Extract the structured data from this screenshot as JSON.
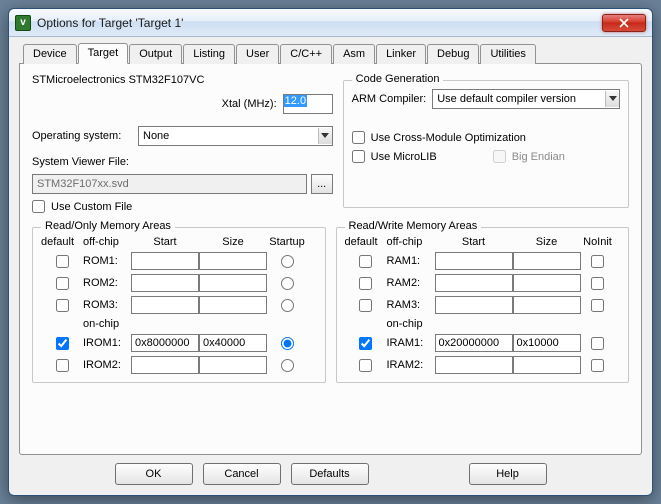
{
  "window": {
    "title": "Options for Target 'Target 1'"
  },
  "tabs": [
    "Device",
    "Target",
    "Output",
    "Listing",
    "User",
    "C/C++",
    "Asm",
    "Linker",
    "Debug",
    "Utilities"
  ],
  "active_tab": 1,
  "target": {
    "mcu_label": "STMicroelectronics STM32F107VC",
    "xtal_label": "Xtal (MHz):",
    "xtal_value": "12.0",
    "os_label": "Operating system:",
    "os_value": "None",
    "svf_label": "System Viewer File:",
    "svf_value": "STM32F107xx.svd",
    "svf_browse": "...",
    "custom_file_label": "Use Custom File",
    "custom_file_checked": false
  },
  "codegen": {
    "group": "Code Generation",
    "compiler_label": "ARM Compiler:",
    "compiler_value": "Use default compiler version",
    "cross_label": "Use Cross-Module Optimization",
    "cross_checked": false,
    "microlib_label": "Use MicroLIB",
    "microlib_checked": false,
    "bigendian_label": "Big Endian",
    "bigendian_checked": false
  },
  "ro": {
    "group": "Read/Only Memory Areas",
    "hdr_default": "default",
    "hdr_offchip": "off-chip",
    "hdr_start": "Start",
    "hdr_size": "Size",
    "hdr_startup": "Startup",
    "hdr_onchip": "on-chip",
    "rows_off": [
      {
        "label": "ROM1:",
        "checked": false,
        "start": "",
        "size": "",
        "startup": false
      },
      {
        "label": "ROM2:",
        "checked": false,
        "start": "",
        "size": "",
        "startup": false
      },
      {
        "label": "ROM3:",
        "checked": false,
        "start": "",
        "size": "",
        "startup": false
      }
    ],
    "rows_on": [
      {
        "label": "IROM1:",
        "checked": true,
        "start": "0x8000000",
        "size": "0x40000",
        "startup": true
      },
      {
        "label": "IROM2:",
        "checked": false,
        "start": "",
        "size": "",
        "startup": false
      }
    ]
  },
  "rw": {
    "group": "Read/Write Memory Areas",
    "hdr_default": "default",
    "hdr_offchip": "off-chip",
    "hdr_start": "Start",
    "hdr_size": "Size",
    "hdr_noinit": "NoInit",
    "hdr_onchip": "on-chip",
    "rows_off": [
      {
        "label": "RAM1:",
        "checked": false,
        "start": "",
        "size": "",
        "noinit": false
      },
      {
        "label": "RAM2:",
        "checked": false,
        "start": "",
        "size": "",
        "noinit": false
      },
      {
        "label": "RAM3:",
        "checked": false,
        "start": "",
        "size": "",
        "noinit": false
      }
    ],
    "rows_on": [
      {
        "label": "IRAM1:",
        "checked": true,
        "start": "0x20000000",
        "size": "0x10000",
        "noinit": false
      },
      {
        "label": "IRAM2:",
        "checked": false,
        "start": "",
        "size": "",
        "noinit": false
      }
    ]
  },
  "buttons": {
    "ok": "OK",
    "cancel": "Cancel",
    "defaults": "Defaults",
    "help": "Help"
  }
}
